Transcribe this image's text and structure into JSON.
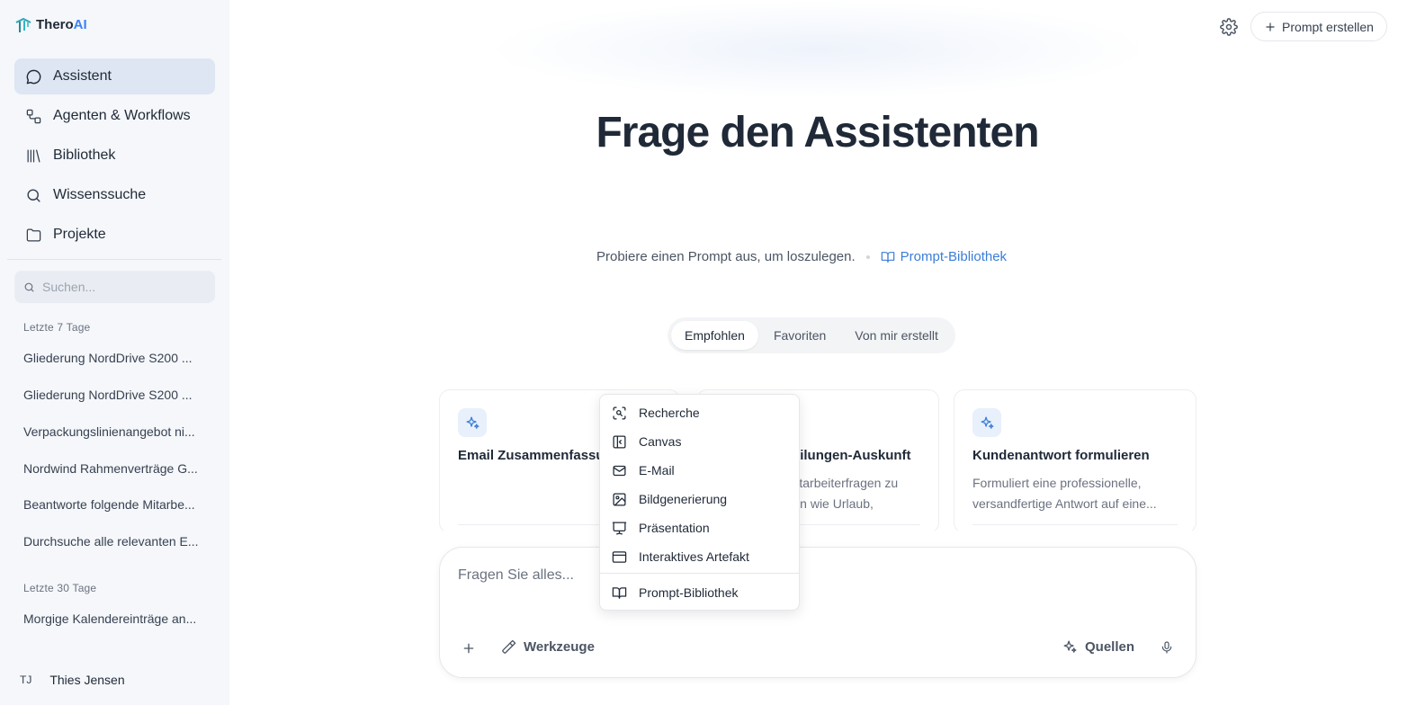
{
  "app": {
    "name_main": "Thero",
    "name_accent": "AI"
  },
  "nav": [
    {
      "label": "Assistent",
      "icon": "chat-bubble-icon",
      "active": true
    },
    {
      "label": "Agenten & Workflows",
      "icon": "workflow-icon",
      "active": false
    },
    {
      "label": "Bibliothek",
      "icon": "library-icon",
      "active": false
    },
    {
      "label": "Wissenssuche",
      "icon": "search-icon",
      "active": false
    },
    {
      "label": "Projekte",
      "icon": "folder-icon",
      "active": false
    }
  ],
  "search": {
    "placeholder": "Suchen..."
  },
  "history": {
    "section_7": "Letzte 7 Tage",
    "items_7": [
      "Gliederung NordDrive S200 ...",
      "Gliederung NordDrive S200 ...",
      "Verpackungslinienangebot ni...",
      "Nordwind Rahmenverträge G...",
      "Beantworte folgende Mitarbe...",
      "Durchsuche alle relevanten E..."
    ],
    "section_30": "Letzte 30 Tage",
    "items_30": [
      "Morgige Kalendereinträge an..."
    ]
  },
  "user": {
    "initials": "TJ",
    "name": "Thies Jensen"
  },
  "header": {
    "create_label": "Prompt erstellen"
  },
  "main": {
    "title": "Frage den Assistenten",
    "hint": "Probiere einen Prompt aus, um loszulegen.",
    "library_link": "Prompt-Bibliothek",
    "tabs": [
      {
        "label": "Empfohlen",
        "active": true
      },
      {
        "label": "Favoriten",
        "active": false
      },
      {
        "label": "Von mir erstellt",
        "active": false
      }
    ],
    "cards": [
      {
        "title": "Email Zusammenfassung",
        "description": ""
      },
      {
        "title": "Personalabteilungen-Auskunft",
        "description": "Beantwortet Mitarbeiterfragen zu Personalthemen wie Urlaub, Arbeitszeit,..."
      },
      {
        "title": "Kundenantwort formulieren",
        "description": "Formuliert eine professionelle, versandfertige Antwort auf eine..."
      }
    ]
  },
  "composer": {
    "placeholder": "Fragen Sie alles...",
    "tools_label": "Werkzeuge",
    "sources_label": "Quellen"
  },
  "tools_menu": {
    "items": [
      {
        "label": "Recherche",
        "icon": "scan-search-icon"
      },
      {
        "label": "Canvas",
        "icon": "canvas-panel-icon"
      },
      {
        "label": "E-Mail",
        "icon": "mail-icon"
      },
      {
        "label": "Bildgenerierung",
        "icon": "image-icon"
      },
      {
        "label": "Präsentation",
        "icon": "presentation-icon"
      },
      {
        "label": "Interaktives Artefakt",
        "icon": "app-window-icon"
      }
    ],
    "footer_item": {
      "label": "Prompt-Bibliothek",
      "icon": "book-open-icon"
    }
  },
  "colors": {
    "accent": "#3b7dd8",
    "sidebar_bg": "#f5f7fa",
    "active_nav_bg": "#dde6f2",
    "title_text": "#1f2937"
  }
}
